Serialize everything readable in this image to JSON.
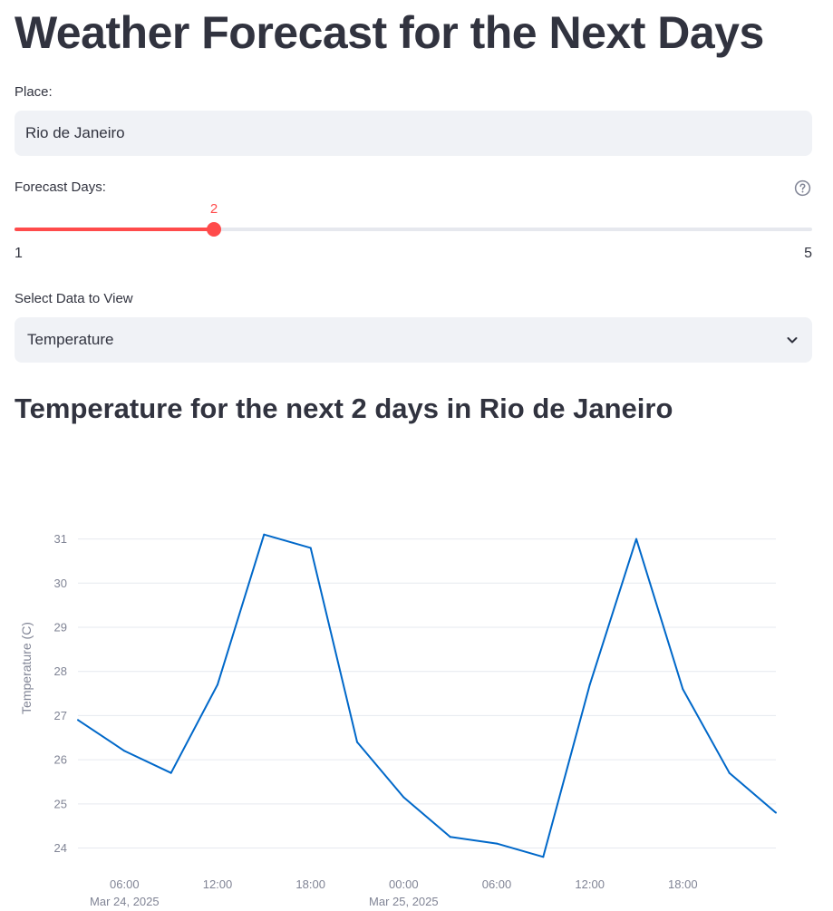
{
  "page": {
    "title": "Weather Forecast for the Next Days"
  },
  "place": {
    "label": "Place:",
    "value": "Rio de Janeiro"
  },
  "forecast_days": {
    "label": "Forecast Days:",
    "value": 2,
    "value_text": "2",
    "min": 1,
    "max": 5,
    "min_text": "1",
    "max_text": "5",
    "help_icon": "question-circle-icon"
  },
  "data_select": {
    "label": "Select Data to View",
    "value": "Temperature",
    "icon": "chevron-down-icon"
  },
  "chart_heading": "Temperature for the next 2 days in Rio de Janeiro",
  "colors": {
    "accent": "#ff4b4b",
    "line": "#0068c9",
    "input_bg": "#f0f2f6",
    "text": "#31333f"
  },
  "chart_data": {
    "type": "line",
    "ylabel": "Temperature (C)",
    "x": [
      "2025-03-24 03:00",
      "2025-03-24 06:00",
      "2025-03-24 09:00",
      "2025-03-24 12:00",
      "2025-03-24 15:00",
      "2025-03-24 18:00",
      "2025-03-24 21:00",
      "2025-03-25 00:00",
      "2025-03-25 03:00",
      "2025-03-25 06:00",
      "2025-03-25 09:00",
      "2025-03-25 12:00",
      "2025-03-25 15:00",
      "2025-03-25 18:00",
      "2025-03-25 21:00",
      "2025-03-26 00:00"
    ],
    "series": [
      {
        "values": [
          26.9,
          26.2,
          25.7,
          27.7,
          31.1,
          30.8,
          26.4,
          25.15,
          24.25,
          24.1,
          23.8,
          27.7,
          31.0,
          27.6,
          25.7,
          24.8
        ]
      }
    ],
    "yticks": [
      24,
      25,
      26,
      27,
      28,
      29,
      30,
      31
    ],
    "ylim": [
      23.6,
      31.3
    ],
    "xticks": [
      {
        "at": "2025-03-24 06:00",
        "label": "06:00",
        "sublabel": "Mar 24, 2025"
      },
      {
        "at": "2025-03-24 12:00",
        "label": "12:00",
        "sublabel": ""
      },
      {
        "at": "2025-03-24 18:00",
        "label": "18:00",
        "sublabel": ""
      },
      {
        "at": "2025-03-25 00:00",
        "label": "00:00",
        "sublabel": "Mar 25, 2025"
      },
      {
        "at": "2025-03-25 06:00",
        "label": "06:00",
        "sublabel": ""
      },
      {
        "at": "2025-03-25 12:00",
        "label": "12:00",
        "sublabel": ""
      },
      {
        "at": "2025-03-25 18:00",
        "label": "18:00",
        "sublabel": ""
      }
    ],
    "grid": true,
    "legend": "none"
  }
}
